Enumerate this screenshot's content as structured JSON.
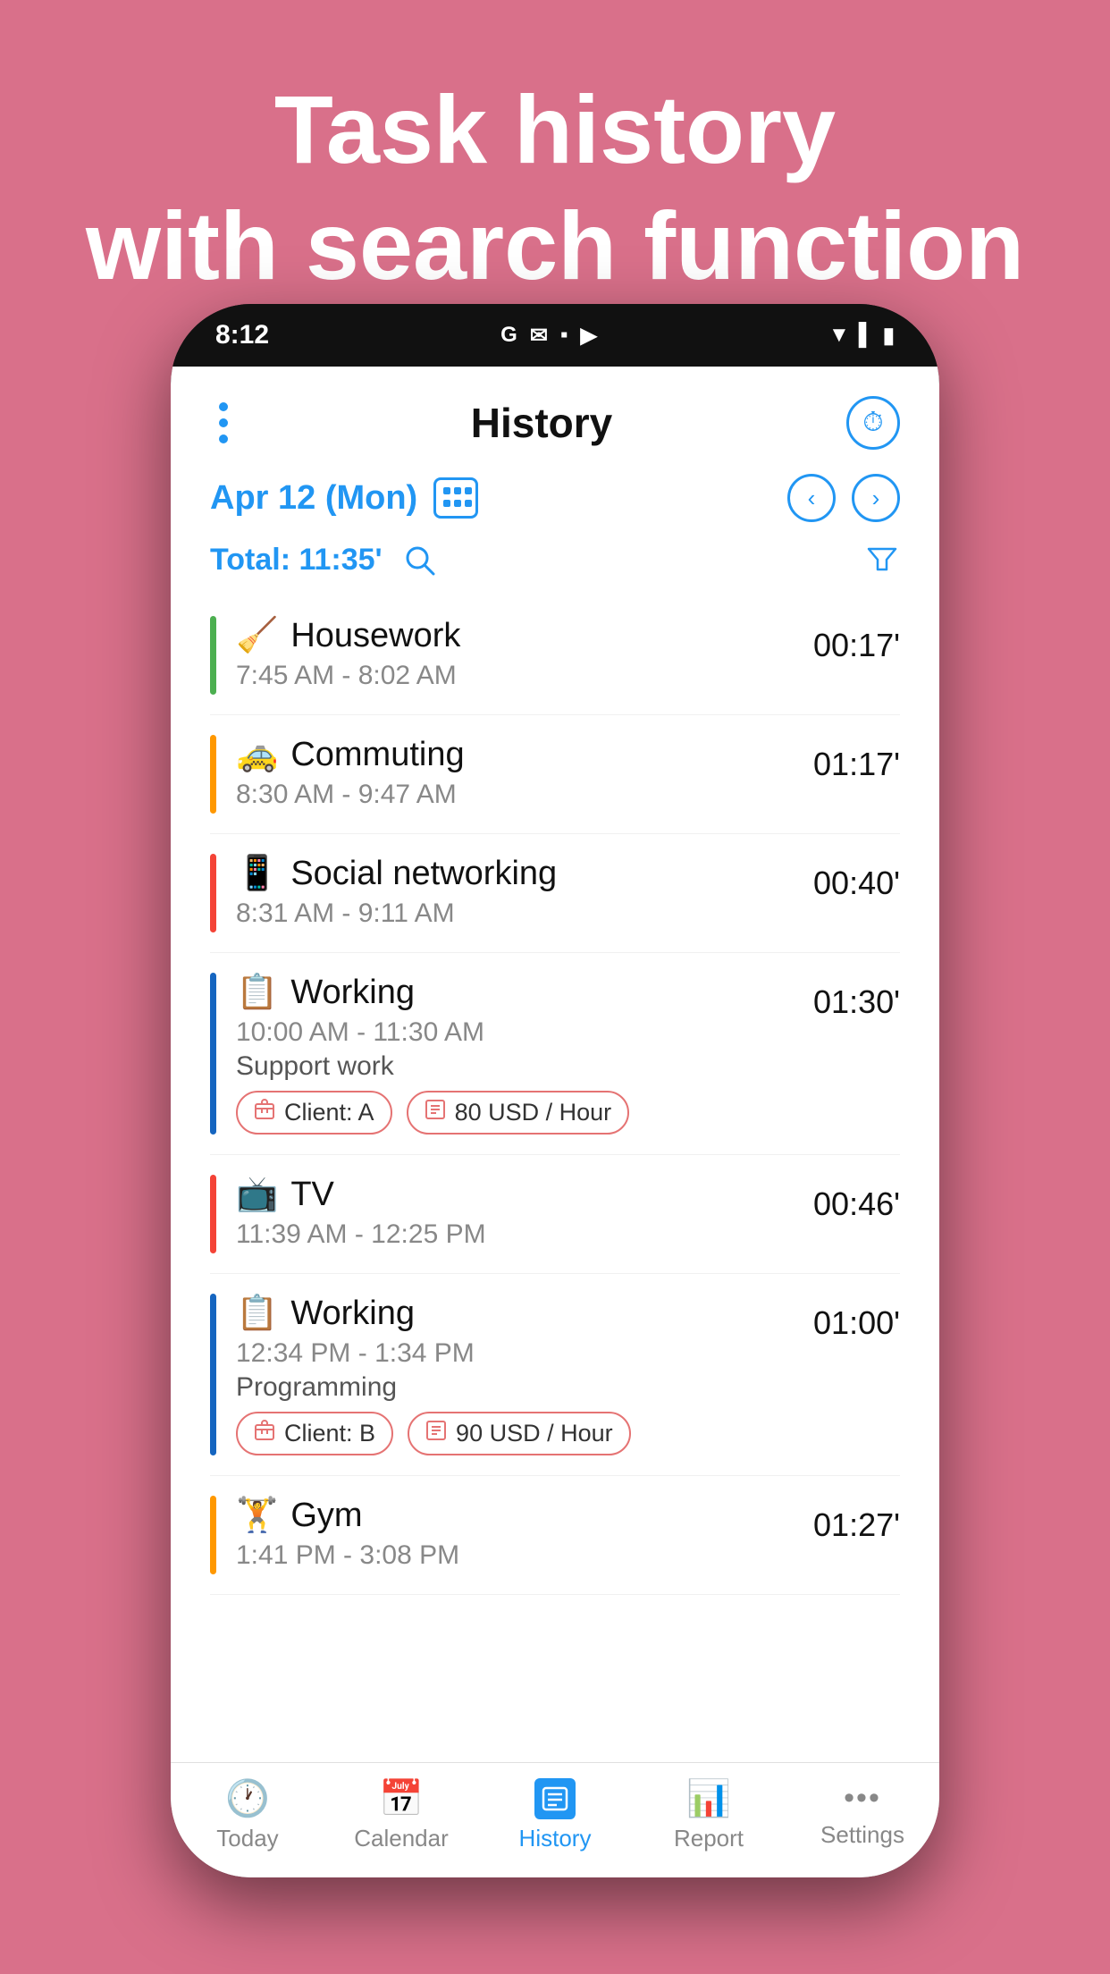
{
  "hero": {
    "line1": "Task history",
    "line2": "with search function"
  },
  "statusBar": {
    "time": "8:12",
    "icons": [
      "G",
      "✉",
      "▪",
      "▶"
    ]
  },
  "appTitle": "History",
  "dateLabel": "Apr 12 (Mon)",
  "totalLabel": "Total: 11:35'",
  "tasks": [
    {
      "id": 1,
      "color": "#4CAF50",
      "emoji": "🧹",
      "name": "Housework",
      "timeRange": "7:45 AM - 8:02 AM",
      "note": "",
      "tags": [],
      "duration": "00:17'"
    },
    {
      "id": 2,
      "color": "#FF9800",
      "emoji": "🚕",
      "name": "Commuting",
      "timeRange": "8:30 AM - 9:47 AM",
      "note": "",
      "tags": [],
      "duration": "01:17'"
    },
    {
      "id": 3,
      "color": "#f44336",
      "emoji": "📱",
      "name": "Social networking",
      "timeRange": "8:31 AM - 9:11 AM",
      "note": "",
      "tags": [],
      "duration": "00:40'"
    },
    {
      "id": 4,
      "color": "#1565C0",
      "emoji": "📋",
      "name": "Working",
      "timeRange": "10:00 AM - 11:30 AM",
      "note": "Support work",
      "tags": [
        {
          "label": "Client: A",
          "icon": "📦"
        },
        {
          "label": "80 USD / Hour",
          "icon": "📊"
        }
      ],
      "duration": "01:30'"
    },
    {
      "id": 5,
      "color": "#f44336",
      "emoji": "📺",
      "name": "TV",
      "timeRange": "11:39 AM - 12:25 PM",
      "note": "",
      "tags": [],
      "duration": "00:46'"
    },
    {
      "id": 6,
      "color": "#1565C0",
      "emoji": "📋",
      "name": "Working",
      "timeRange": "12:34 PM - 1:34 PM",
      "note": "Programming",
      "tags": [
        {
          "label": "Client: B",
          "icon": "📦"
        },
        {
          "label": "90 USD / Hour",
          "icon": "📊"
        }
      ],
      "duration": "01:00'"
    },
    {
      "id": 7,
      "color": "#FF9800",
      "emoji": "🏋",
      "name": "Gym",
      "timeRange": "1:41 PM - 3:08 PM",
      "note": "",
      "tags": [],
      "duration": "01:27'"
    }
  ],
  "bottomNav": [
    {
      "id": "today",
      "label": "Today",
      "icon": "🕐",
      "active": false
    },
    {
      "id": "calendar",
      "label": "Calendar",
      "icon": "📅",
      "active": false
    },
    {
      "id": "history",
      "label": "History",
      "icon": "📋",
      "active": true
    },
    {
      "id": "report",
      "label": "Report",
      "icon": "📊",
      "active": false
    },
    {
      "id": "settings",
      "label": "Settings",
      "icon": "•••",
      "active": false
    }
  ]
}
